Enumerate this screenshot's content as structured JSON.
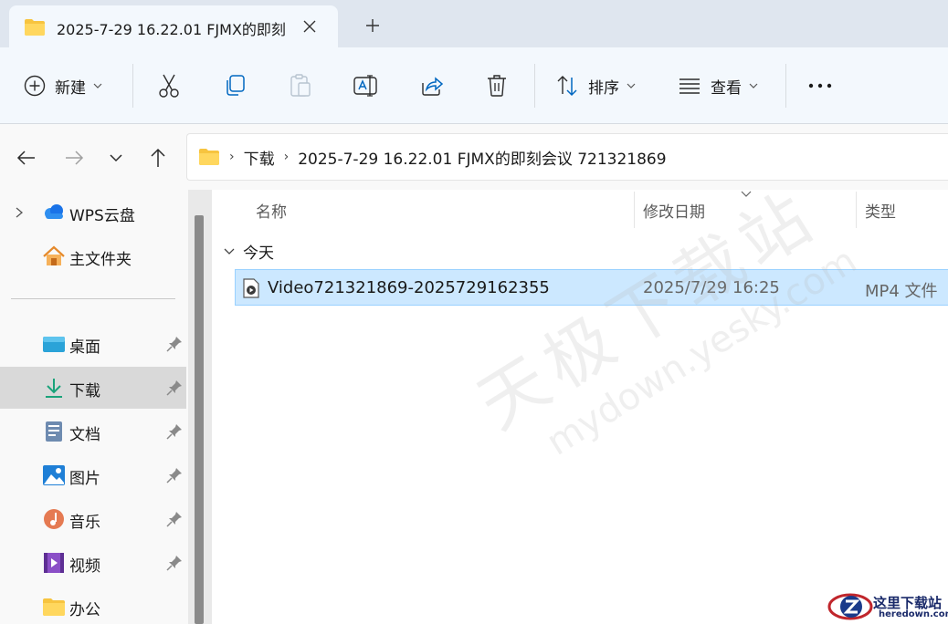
{
  "tab": {
    "title": "2025-7-29 16.22.01 FJMX的即刻会议 721321869",
    "close_glyph": "✕",
    "new_tab_glyph": "+"
  },
  "toolbar": {
    "new_label": "新建",
    "sort_label": "排序",
    "view_label": "查看",
    "more_glyph": "•••"
  },
  "address": {
    "crumbs": [
      "下载",
      "2025-7-29 16.22.01 FJMX的即刻会议 721321869"
    ],
    "sep_glyph": "›"
  },
  "sidebar": {
    "items": [
      {
        "label": "WPS云盘",
        "icon": "cloud-icon",
        "pinned": false
      },
      {
        "label": "主文件夹",
        "icon": "home-icon",
        "pinned": false
      },
      {
        "label": "桌面",
        "icon": "desktop-icon",
        "pinned": true
      },
      {
        "label": "下载",
        "icon": "download-icon",
        "pinned": true,
        "selected": true
      },
      {
        "label": "文档",
        "icon": "document-icon",
        "pinned": true
      },
      {
        "label": "图片",
        "icon": "pictures-icon",
        "pinned": true
      },
      {
        "label": "音乐",
        "icon": "music-icon",
        "pinned": true
      },
      {
        "label": "视频",
        "icon": "video-icon",
        "pinned": true
      },
      {
        "label": "办公",
        "icon": "folder-icon",
        "pinned": false
      }
    ]
  },
  "content": {
    "columns": [
      "名称",
      "修改日期",
      "类型"
    ],
    "group_label": "今天",
    "rows": [
      {
        "name": "Video721321869-2025729162355",
        "date": "2025/7/29 16:25",
        "type": "MP4 文件",
        "selected": true
      }
    ]
  },
  "watermark": {
    "main": "天极下载站",
    "sub": "mydown.yesky.com"
  },
  "corner_logo": {
    "line1": "这里下载站",
    "line2": "heredown.com"
  },
  "colors": {
    "selection_bg": "#cce8ff",
    "selection_border": "#99d1ff",
    "tab_bar": "#dfe6ef",
    "toolbar_bg": "#f3f8fd",
    "accent": "#0067c0"
  }
}
